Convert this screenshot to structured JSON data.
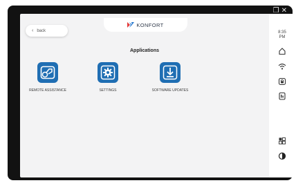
{
  "window": {
    "controls": [
      "restore-icon",
      "close-icon"
    ]
  },
  "header": {
    "back_label": "back",
    "brand": "KONFORT"
  },
  "main": {
    "title": "Applications",
    "apps": [
      {
        "label": "REMOTE ASSISTANCE",
        "icon": "remote-assistance-icon"
      },
      {
        "label": "SETTINGS",
        "icon": "gear-icon"
      },
      {
        "label": "SOFTWARE UPDATES",
        "icon": "download-icon"
      }
    ]
  },
  "status_rail": {
    "time": "8:35",
    "period": "PM",
    "icons": [
      "home-icon",
      "wifi-icon",
      "lock-icon",
      "storage-icon",
      "apps-icon",
      "contrast-icon"
    ]
  },
  "colors": {
    "accent": "#1f6eb3",
    "bezel": "#121212",
    "screen": "#f3f3f4"
  }
}
